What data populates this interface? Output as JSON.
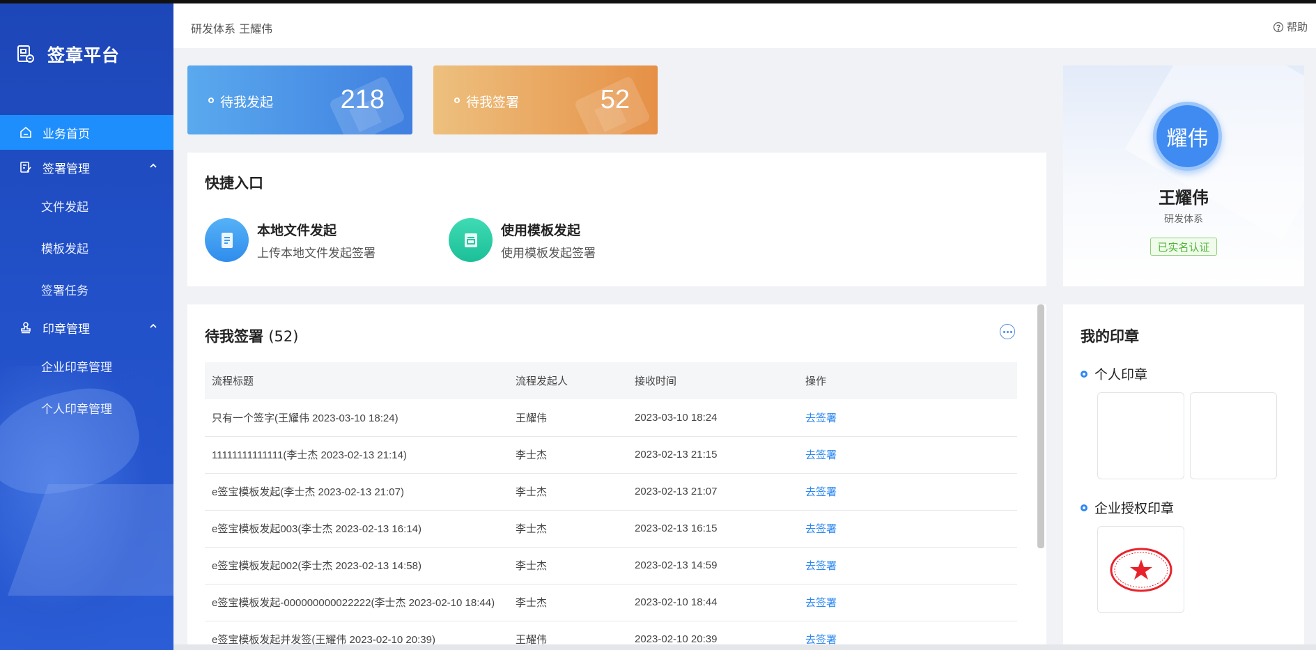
{
  "app": {
    "title": "签章平台"
  },
  "sidebar": {
    "items": [
      {
        "label": "业务首页",
        "icon": "home-icon",
        "active": true
      },
      {
        "label": "签署管理",
        "icon": "sign-manage-icon",
        "expanded": true,
        "children": [
          {
            "label": "文件发起"
          },
          {
            "label": "模板发起"
          },
          {
            "label": "签署任务"
          }
        ]
      },
      {
        "label": "印章管理",
        "icon": "stamp-icon",
        "expanded": true,
        "children": [
          {
            "label": "企业印章管理"
          },
          {
            "label": "个人印章管理"
          }
        ]
      }
    ]
  },
  "header": {
    "breadcrumb": "研发体系 王耀伟",
    "help": "帮助"
  },
  "stats": [
    {
      "label": "待我发起",
      "value": "218",
      "color": "#4a8fe6"
    },
    {
      "label": "待我签署",
      "value": "52",
      "color": "#e9a05a"
    }
  ],
  "quick": {
    "title": "快捷入口",
    "entries": [
      {
        "title": "本地文件发起",
        "subtitle": "上传本地文件发起签署",
        "icon": "document-icon",
        "color": "#3d9df0"
      },
      {
        "title": "使用模板发起",
        "subtitle": "使用模板发起签署",
        "icon": "template-icon",
        "color": "#26c9a3"
      }
    ]
  },
  "pending": {
    "title": "待我签署",
    "count": "(52)",
    "columns": [
      "流程标题",
      "流程发起人",
      "接收时间",
      "操作"
    ],
    "rows": [
      {
        "title": "只有一个签字(王耀伟 2023-03-10 18:24)",
        "initiator": "王耀伟",
        "time": "2023-03-10 18:24",
        "action": "去签署"
      },
      {
        "title": "11111111111111(李士杰 2023-02-13 21:14)",
        "initiator": "李士杰",
        "time": "2023-02-13 21:15",
        "action": "去签署"
      },
      {
        "title": "e签宝模板发起(李士杰 2023-02-13 21:07)",
        "initiator": "李士杰",
        "time": "2023-02-13 21:07",
        "action": "去签署"
      },
      {
        "title": "e签宝模板发起003(李士杰 2023-02-13 16:14)",
        "initiator": "李士杰",
        "time": "2023-02-13 16:15",
        "action": "去签署"
      },
      {
        "title": "e签宝模板发起002(李士杰 2023-02-13 14:58)",
        "initiator": "李士杰",
        "time": "2023-02-13 14:59",
        "action": "去签署"
      },
      {
        "title": "e签宝模板发起-000000000022222(李士杰 2023-02-10 18:44)",
        "initiator": "李士杰",
        "time": "2023-02-10 18:44",
        "action": "去签署"
      },
      {
        "title": "e签宝模板发起并发签(王耀伟 2023-02-10 20:39)",
        "initiator": "王耀伟",
        "time": "2023-02-10 20:39",
        "action": "去签署"
      }
    ]
  },
  "profile": {
    "avatar": "耀伟",
    "name": "王耀伟",
    "dept": "研发体系",
    "badge": "已实名认证"
  },
  "seals": {
    "title": "我的印章",
    "personal_title": "个人印章",
    "enterprise_title": "企业授权印章"
  }
}
